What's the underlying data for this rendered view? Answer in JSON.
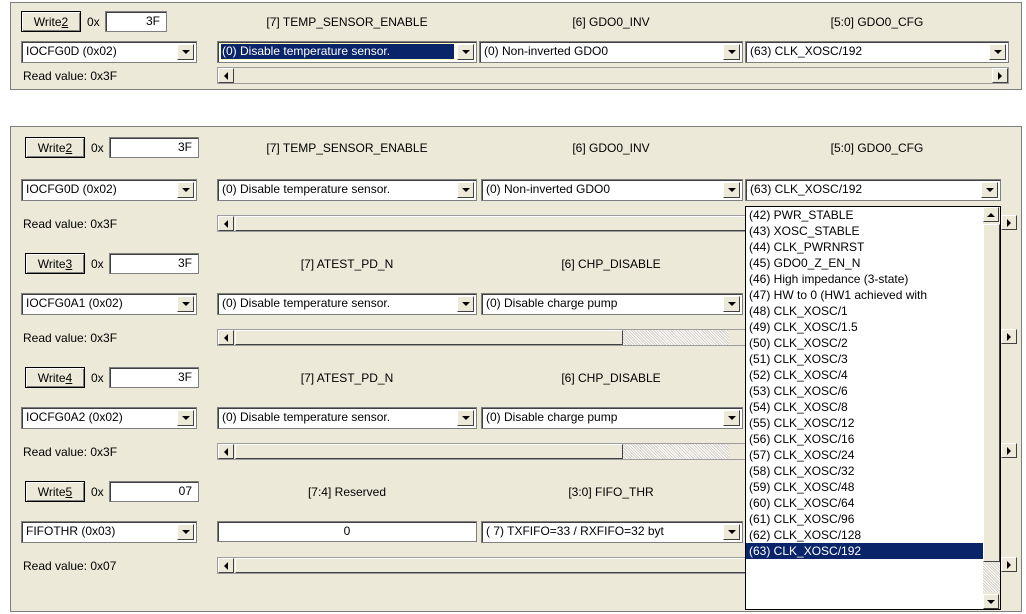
{
  "top": {
    "write_label": "Write ",
    "write_key": "2",
    "hex_prefix": "0x",
    "hex_value": "3F",
    "headers": [
      "[7] TEMP_SENSOR_ENABLE",
      "[6] GDO0_INV",
      "[5:0] GDO0_CFG"
    ],
    "register": "IOCFG0D (0x02)",
    "fields": [
      "(0) Disable temperature sensor.",
      "(0) Non-inverted GDO0",
      "(63) CLK_XOSC/192"
    ],
    "read_value": "Read value: 0x3F"
  },
  "rows": [
    {
      "write_label": "Write ",
      "write_key": "2",
      "hex_prefix": "0x",
      "hex_value": "3F",
      "headers": [
        "[7] TEMP_SENSOR_ENABLE",
        "[6] GDO0_INV",
        "[5:0] GDO0_CFG"
      ],
      "register": "IOCFG0D (0x02)",
      "fields": [
        "(0) Disable temperature sensor.",
        "(0) Non-inverted GDO0",
        "(63) CLK_XOSC/192"
      ],
      "read_value": "Read value: 0x3F"
    },
    {
      "write_label": "Write ",
      "write_key": "3",
      "hex_prefix": "0x",
      "hex_value": "3F",
      "headers": [
        "[7] ATEST_PD_N",
        "[6] CHP_DISABLE"
      ],
      "register": "IOCFG0A1 (0x02)",
      "fields": [
        "(0) Disable temperature sensor.",
        "(0) Disable charge pump"
      ],
      "read_value": "Read value: 0x3F"
    },
    {
      "write_label": "Write ",
      "write_key": "4",
      "hex_prefix": "0x",
      "hex_value": "3F",
      "headers": [
        "[7] ATEST_PD_N",
        "[6] CHP_DISABLE"
      ],
      "register": "IOCFG0A2 (0x02)",
      "fields": [
        "(0) Disable temperature sensor.",
        "(0) Disable charge pump"
      ],
      "read_value": "Read value: 0x3F"
    },
    {
      "write_label": "Write ",
      "write_key": "5",
      "hex_prefix": "0x",
      "hex_value": "07",
      "headers": [
        "[7:4] Reserved",
        "[3:0] FIFO_THR"
      ],
      "register": "FIFOTHR (0x03)",
      "fields": [
        "0",
        "( 7) TXFIFO=33 / RXFIFO=32 byt"
      ],
      "read_value": "Read value: 0x07"
    }
  ],
  "dropdown_list": [
    "(42) PWR_STABLE",
    "(43) XOSC_STABLE",
    "(44) CLK_PWRNRST",
    "(45) GDO0_Z_EN_N",
    "(46) High impedance (3-state)",
    "(47) HW to 0 (HW1 achieved with",
    "(48) CLK_XOSC/1",
    "(49) CLK_XOSC/1.5",
    "(50) CLK_XOSC/2",
    "(51) CLK_XOSC/3",
    "(52) CLK_XOSC/4",
    "(53) CLK_XOSC/6",
    "(54) CLK_XOSC/8",
    "(55) CLK_XOSC/12",
    "(56) CLK_XOSC/16",
    "(57) CLK_XOSC/24",
    "(58) CLK_XOSC/32",
    "(59) CLK_XOSC/48",
    "(60) CLK_XOSC/64",
    "(61) CLK_XOSC/96",
    "(62) CLK_XOSC/128",
    "(63) CLK_XOSC/192"
  ],
  "dropdown_selected_index": 21,
  "colors": {
    "panel": "#ece9d8",
    "selection": "#0a246a"
  },
  "icons": [
    "dropdown-arrow-icon",
    "scroll-left-icon",
    "scroll-right-icon",
    "scroll-up-icon",
    "scroll-down-icon"
  ]
}
